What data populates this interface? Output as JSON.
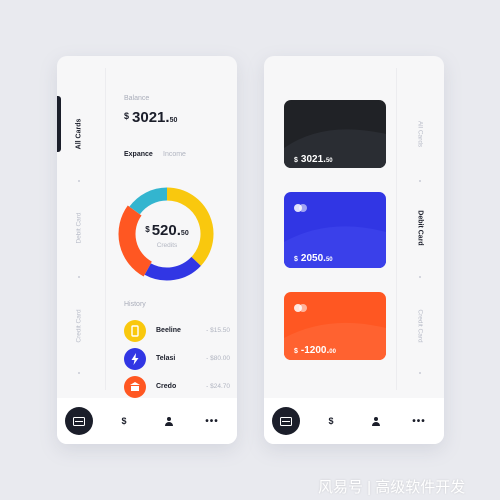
{
  "left_screen": {
    "tabs": [
      {
        "label": "All Cards",
        "active": true
      },
      {
        "label": "Debit Card",
        "active": false
      },
      {
        "label": "Credit Card",
        "active": false
      }
    ],
    "balance_label": "Balance",
    "balance": {
      "currency": "$",
      "main": "3021.",
      "cents": "50"
    },
    "tab_expance": "Expance",
    "tab_income": "Income",
    "donut": {
      "currency": "$",
      "main": "520.",
      "cents": "50",
      "label": "Credits",
      "segments": [
        {
          "color": "#f9c80e",
          "value": 37
        },
        {
          "color": "#3136e4",
          "value": 21
        },
        {
          "color": "#ff5722",
          "value": 27
        },
        {
          "color": "#33b5cf",
          "value": 15
        }
      ]
    },
    "history_label": "History",
    "history": [
      {
        "name": "Beeline",
        "amount": "- $15.50",
        "color": "#f9c80e",
        "icon": "phone-icon"
      },
      {
        "name": "Telasi",
        "amount": "- $80.00",
        "color": "#3136e4",
        "icon": "lightning-icon"
      },
      {
        "name": "Credo",
        "amount": "- $24.70",
        "color": "#ff5722",
        "icon": "bank-icon"
      }
    ]
  },
  "right_screen": {
    "tabs": [
      {
        "label": "All Cards",
        "active": false
      },
      {
        "label": "Debit Card",
        "active": true
      },
      {
        "label": "Credit Card",
        "active": false
      }
    ],
    "cards": [
      {
        "color": "#202226",
        "currency": "$",
        "main": "3021.",
        "cents": "50",
        "has_logo": false
      },
      {
        "color": "#3136e4",
        "currency": "$",
        "main": "2050.",
        "cents": "50",
        "has_logo": true
      },
      {
        "color": "#ff5722",
        "currency": "$",
        "main": "-1200.",
        "cents": "00",
        "has_logo": true
      }
    ]
  },
  "bottom_nav": {
    "items": [
      {
        "icon": "card-icon",
        "glyph": "",
        "active": true
      },
      {
        "icon": "dollar-icon",
        "glyph": "$",
        "active": false
      },
      {
        "icon": "user-icon",
        "glyph": "",
        "active": false
      },
      {
        "icon": "more-icon",
        "glyph": "•••",
        "active": false
      }
    ]
  },
  "watermark": "风易号 | 高级软件开发"
}
